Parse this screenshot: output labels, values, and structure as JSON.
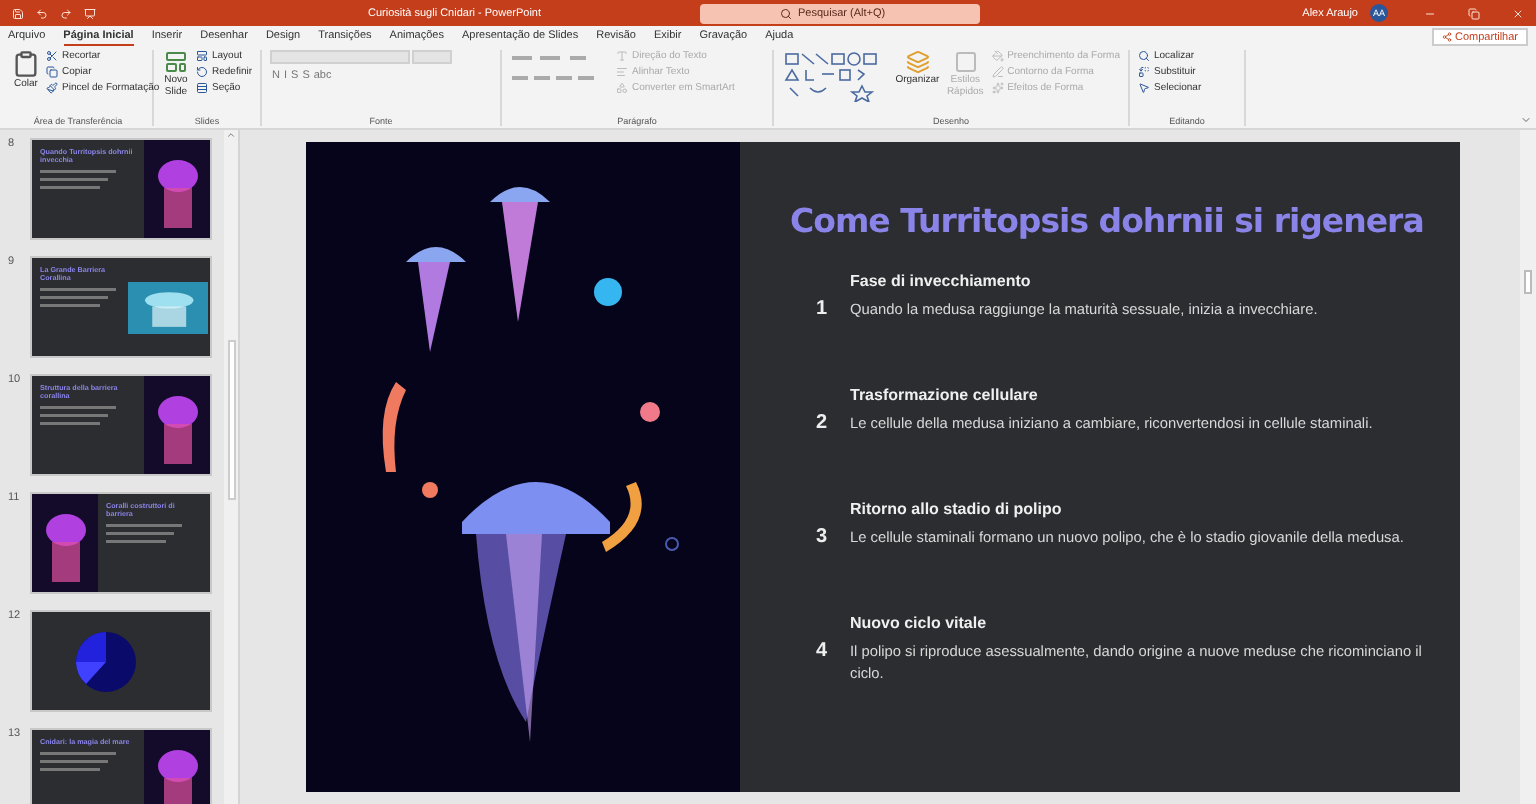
{
  "window": {
    "title": "Curiosità sugli Cnidari - PowerPoint",
    "search_placeholder": "Pesquisar (Alt+Q)",
    "user": "Alex Araujo",
    "avatar": "AA"
  },
  "tabs": [
    {
      "label": "Arquivo",
      "selected": false
    },
    {
      "label": "Página Inicial",
      "selected": true
    },
    {
      "label": "Inserir",
      "selected": false
    },
    {
      "label": "Desenhar",
      "selected": false
    },
    {
      "label": "Design",
      "selected": false
    },
    {
      "label": "Transições",
      "selected": false
    },
    {
      "label": "Animações",
      "selected": false
    },
    {
      "label": "Apresentação de Slides",
      "selected": false
    },
    {
      "label": "Revisão",
      "selected": false
    },
    {
      "label": "Exibir",
      "selected": false
    },
    {
      "label": "Gravação",
      "selected": false
    },
    {
      "label": "Ajuda",
      "selected": false
    }
  ],
  "share": "Compartilhar",
  "ribbon": {
    "clipboard": {
      "label": "Área de Transferência",
      "paste": "Colar",
      "items": [
        {
          "label": "Recortar",
          "disabled": false
        },
        {
          "label": "Copiar",
          "disabled": false
        },
        {
          "label": "Pincel de Formatação",
          "disabled": false
        }
      ]
    },
    "slides": {
      "label": "Slides",
      "new_slide": "Novo Slide",
      "items": [
        {
          "label": "Layout",
          "disabled": false
        },
        {
          "label": "Redefinir",
          "disabled": false
        },
        {
          "label": "Seção",
          "disabled": false
        }
      ]
    },
    "font": {
      "label": "Fonte",
      "buttons": [
        "N",
        "I",
        "S",
        "S",
        "abc"
      ]
    },
    "paragraph": {
      "label": "Parágrafo",
      "items": [
        {
          "label": "Direção do Texto",
          "disabled": true
        },
        {
          "label": "Alinhar Texto",
          "disabled": true
        },
        {
          "label": "Converter em SmartArt",
          "disabled": true
        }
      ]
    },
    "drawing": {
      "label": "Desenho",
      "arrange": "Organizar",
      "quick_styles": "Estilos Rápidos",
      "items": [
        {
          "label": "Preenchimento da Forma",
          "disabled": true
        },
        {
          "label": "Contorno da Forma",
          "disabled": true
        },
        {
          "label": "Efeitos de Forma",
          "disabled": true
        }
      ]
    },
    "editing": {
      "label": "Editando",
      "items": [
        {
          "label": "Localizar",
          "disabled": false
        },
        {
          "label": "Substituir",
          "disabled": false
        },
        {
          "label": "Selecionar",
          "disabled": false
        }
      ]
    }
  },
  "thumbnails": [
    {
      "number": "8",
      "title": "Quando Turritopsis dohrnii invecchia",
      "kind": "text-image",
      "selected": false
    },
    {
      "number": "9",
      "title": "La Grande Barriera Corallina",
      "kind": "text-photo",
      "selected": false
    },
    {
      "number": "10",
      "title": "Struttura della barriera corallina",
      "kind": "text-image",
      "selected": false
    },
    {
      "number": "11",
      "title": "Coralli costruttori di barriera",
      "kind": "image-text",
      "selected": false
    },
    {
      "number": "12",
      "kind": "pie",
      "selected": false
    },
    {
      "number": "13",
      "title": "Cnidari: la magia del mare",
      "kind": "text-image",
      "selected": false
    }
  ],
  "slide": {
    "title": "Come Turritopsis dohrnii si rigenera",
    "steps": [
      {
        "number": "1",
        "heading": "Fase di invecchiamento",
        "text": "Quando la medusa raggiunge la maturità sessuale, inizia a invecchiare."
      },
      {
        "number": "2",
        "heading": "Trasformazione cellulare",
        "text": "Le cellule della medusa iniziano a cambiare, riconvertendosi in cellule staminali."
      },
      {
        "number": "3",
        "heading": "Ritorno allo stadio di polipo",
        "text": "Le cellule staminali formano un nuovo polipo, che è lo stadio giovanile della medusa."
      },
      {
        "number": "4",
        "heading": "Nuovo ciclo vitale",
        "text": "Il polipo si riproduce asessualmente, dando origine a nuove meduse che ricominciano il ciclo."
      }
    ]
  }
}
